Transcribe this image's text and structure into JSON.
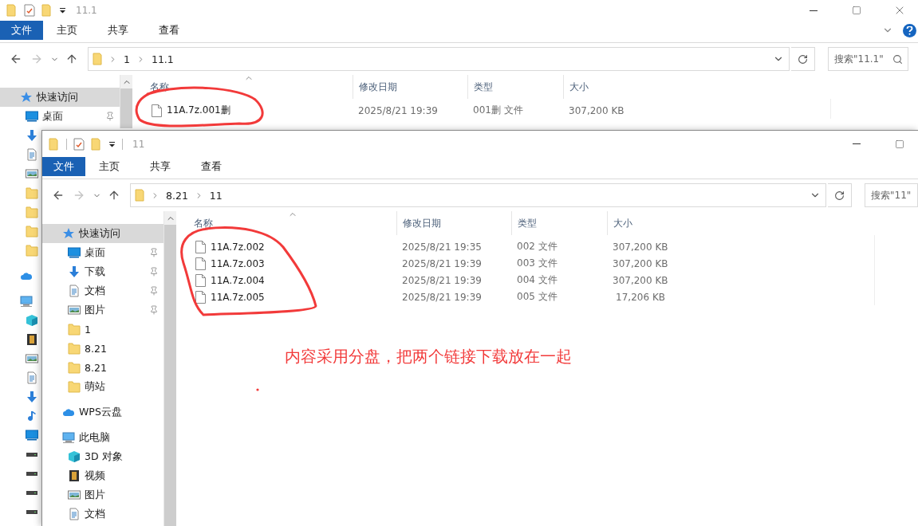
{
  "windows": [
    {
      "title": "11.1",
      "ribbon_tabs": [
        {
          "label": "文件",
          "selected": true
        },
        {
          "label": "主页",
          "selected": false
        },
        {
          "label": "共享",
          "selected": false
        },
        {
          "label": "查看",
          "selected": false
        }
      ],
      "window_buttons": [
        {
          "kind": "minimize"
        },
        {
          "kind": "maximize"
        },
        {
          "kind": "close"
        }
      ],
      "help_button": true,
      "forward": {
        "disabled": true
      },
      "path": [
        "1",
        "11.1"
      ],
      "search": {
        "placeholder": "搜索\"11.1\""
      },
      "sidebar": {
        "items": [
          {
            "kind": "star",
            "label": "快速访问",
            "selected": true,
            "children": [
              {
                "kind": "desktop",
                "label": "桌面",
                "selected": false,
                "pinned": true
              },
              {
                "kind": "download",
                "selected": false
              },
              {
                "kind": "document",
                "selected": false
              },
              {
                "kind": "picture",
                "selected": false
              },
              {
                "kind": "folder",
                "selected": false
              },
              {
                "kind": "folder",
                "selected": false
              },
              {
                "kind": "folder",
                "selected": false
              },
              {
                "kind": "folder",
                "selected": false
              }
            ]
          },
          {
            "kind": "cloud",
            "selected": false
          },
          {
            "kind": "pc",
            "selected": false,
            "children": [
              {
                "kind": "cube",
                "selected": false
              },
              {
                "kind": "film",
                "selected": false
              },
              {
                "kind": "picture",
                "selected": false
              },
              {
                "kind": "document",
                "selected": false
              },
              {
                "kind": "download",
                "selected": false
              },
              {
                "kind": "music",
                "selected": false
              },
              {
                "kind": "desktop",
                "selected": false
              },
              {
                "kind": "drive",
                "selected": false
              },
              {
                "kind": "drive",
                "selected": false
              },
              {
                "kind": "drive",
                "selected": false
              },
              {
                "kind": "drive",
                "selected": false
              }
            ]
          }
        ]
      },
      "columns": [
        "名称",
        "修改日期",
        "类型",
        "大小"
      ],
      "rows": [
        {
          "name": "11A.7z.001删",
          "modified": "2025/8/21 19:39",
          "type": "001删 文件",
          "size": "307,200 KB"
        }
      ]
    },
    {
      "title": "11",
      "ribbon_tabs": [
        {
          "label": "文件",
          "selected": true
        },
        {
          "label": "主页",
          "selected": false
        },
        {
          "label": "共享",
          "selected": false
        },
        {
          "label": "查看",
          "selected": false
        }
      ],
      "window_buttons": [
        {
          "kind": "minimize"
        },
        {
          "kind": "maximize"
        }
      ],
      "help_button": false,
      "forward": {
        "disabled": true
      },
      "path": [
        "8.21",
        "11"
      ],
      "search": {
        "placeholder": "搜索\"11\""
      },
      "sidebar": {
        "items": [
          {
            "kind": "star",
            "label": "快速访问",
            "selected": true,
            "children": [
              {
                "kind": "desktop",
                "label": "桌面",
                "selected": false,
                "pinned": true
              },
              {
                "kind": "download",
                "label": "下载",
                "selected": false,
                "pinned": true
              },
              {
                "kind": "document",
                "label": "文档",
                "selected": false,
                "pinned": true
              },
              {
                "kind": "picture",
                "label": "图片",
                "selected": false,
                "pinned": true
              },
              {
                "kind": "folder",
                "label": "1",
                "selected": false,
                "pinned": false
              },
              {
                "kind": "folder",
                "label": "8.21",
                "selected": false,
                "pinned": false
              },
              {
                "kind": "folder",
                "label": "8.21",
                "selected": false,
                "pinned": false
              },
              {
                "kind": "folder",
                "label": "萌站",
                "selected": false,
                "pinned": false
              }
            ]
          },
          {
            "kind": "cloud",
            "label": "WPS云盘",
            "selected": false
          },
          {
            "kind": "pc",
            "label": "此电脑",
            "selected": false,
            "children": [
              {
                "kind": "cube",
                "label": "3D 对象",
                "selected": false
              },
              {
                "kind": "film",
                "label": "视频",
                "selected": false
              },
              {
                "kind": "picture",
                "label": "图片",
                "selected": false
              },
              {
                "kind": "document",
                "label": "文档",
                "selected": false
              }
            ]
          }
        ]
      },
      "columns": [
        "名称",
        "修改日期",
        "类型",
        "大小"
      ],
      "rows": [
        {
          "name": "11A.7z.002",
          "modified": "2025/8/21 19:35",
          "type": "002 文件",
          "size": "307,200 KB"
        },
        {
          "name": "11A.7z.003",
          "modified": "2025/8/21 19:39",
          "type": "003 文件",
          "size": "307,200 KB"
        },
        {
          "name": "11A.7z.004",
          "modified": "2025/8/21 19:39",
          "type": "004 文件",
          "size": "307,200 KB"
        },
        {
          "name": "11A.7z.005",
          "modified": "2025/8/21 19:39",
          "type": "005 文件",
          "size": "17,206 KB"
        }
      ]
    }
  ],
  "annotation": {
    "text": "内容采用分盘，把两个链接下载放在一起"
  }
}
